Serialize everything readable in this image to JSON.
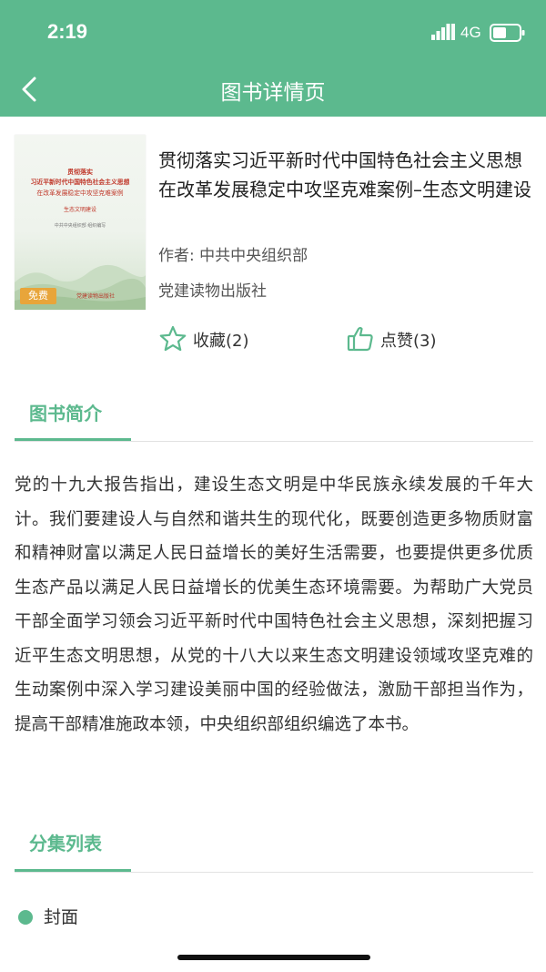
{
  "status_bar": {
    "time": "2:19",
    "network": "4G"
  },
  "nav": {
    "title": "图书详情页"
  },
  "book": {
    "cover": {
      "lines": [
        "贯彻落实",
        "习近平新时代中国特色社会主义思想",
        "在改革发展稳定中攻坚克难案例",
        "生态文明建设",
        "中共中央组织部  组织编写"
      ],
      "badge": "免费",
      "publisher_mark": "党建读物出版社"
    },
    "title": "贯彻落实习近平新时代中国特色社会主义思想在改革发展稳定中攻坚克难案例–生态文明建设",
    "author": "作者: 中共中央组织部",
    "publisher": "党建读物出版社",
    "favorite_label": "收藏(2)",
    "like_label": "点赞(3)"
  },
  "intro": {
    "heading": "图书简介",
    "text": "党的十九大报告指出，建设生态文明是中华民族永续发展的千年大计。我们要建设人与自然和谐共生的现代化，既要创造更多物质财富和精神财富以满足人民日益增长的美好生活需要，也要提供更多优质生态产品以满足人民日益增长的优美生态环境需要。为帮助广大党员干部全面学习领会习近平新时代中国特色社会主义思想，深刻把握习近平生态文明思想，从党的十八大以来生态文明建设领域攻坚克难的生动案例中深入学习建设美丽中国的经验做法，激励干部担当作为，提高干部精准施政本领，中央组织部组织编选了本书。"
  },
  "episodes": {
    "heading": "分集列表",
    "items": [
      {
        "label": "封面"
      }
    ]
  },
  "colors": {
    "accent": "#5cb98e",
    "badge": "#e8a53a"
  }
}
